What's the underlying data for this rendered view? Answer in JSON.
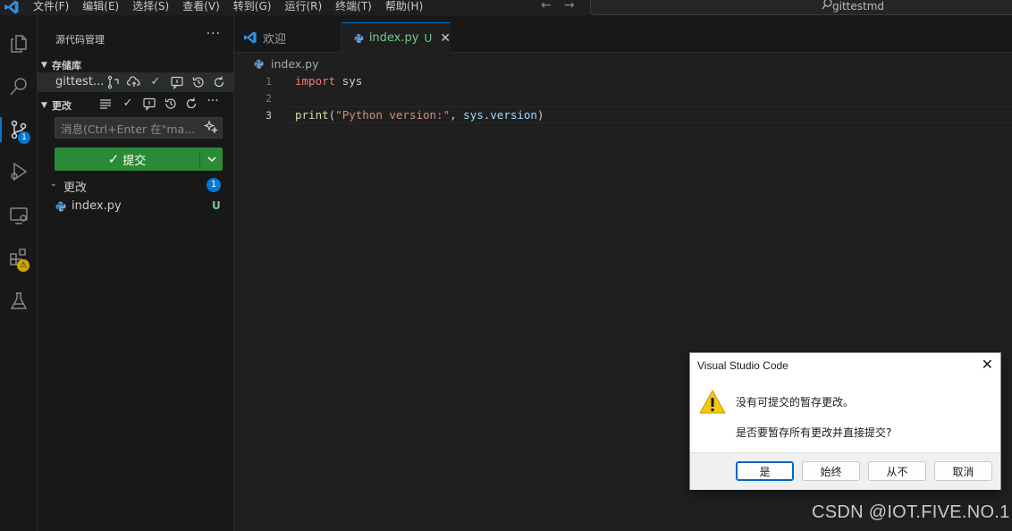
{
  "menu": [
    "文件(F)",
    "编辑(E)",
    "选择(S)",
    "查看(V)",
    "转到(G)",
    "运行(R)",
    "终端(T)",
    "帮助(H)"
  ],
  "nav": {
    "back": "←",
    "forward": "→"
  },
  "search": {
    "text": "gittestmd"
  },
  "activity": {
    "scm_badge": "1",
    "ext_badge": "⚠"
  },
  "sidebar": {
    "title": "源代码管理",
    "more": "···",
    "repos_header": "存储库",
    "repo_name": "gittest...",
    "changes_header": "更改",
    "message_placeholder": "消息(Ctrl+Enter 在\"ma...",
    "commit_label": "提交",
    "changes_group": "更改",
    "changes_count": "1",
    "file": {
      "name": "index.py",
      "status": "U"
    }
  },
  "tabs": [
    {
      "label": "欢迎"
    },
    {
      "label": "index.py",
      "status": "U"
    }
  ],
  "editor": {
    "breadcrumb": "index.py",
    "line_numbers": [
      "1",
      "2",
      "3"
    ],
    "lines": {
      "l1_kw": "import",
      "l1_rest": " sys",
      "l3_fn": "print",
      "l3_p1": "(",
      "l3_str": "\"Python version:\"",
      "l3_p2": ", ",
      "l3_var": "sys",
      "l3_dot": ".",
      "l3_attr": "version",
      "l3_p3": ")"
    }
  },
  "dialog": {
    "title": "Visual Studio Code",
    "message": "没有可提交的暂存更改。",
    "detail": "是否要暂存所有更改并直接提交?",
    "buttons": {
      "yes": "是",
      "always": "始终",
      "never": "从不",
      "cancel": "取消"
    }
  },
  "watermark": "CSDN @IOT.FIVE.NO.1",
  "colors": {
    "accent": "#0078d4",
    "commit_button": "#2a8a36",
    "untracked": "#73c991"
  }
}
